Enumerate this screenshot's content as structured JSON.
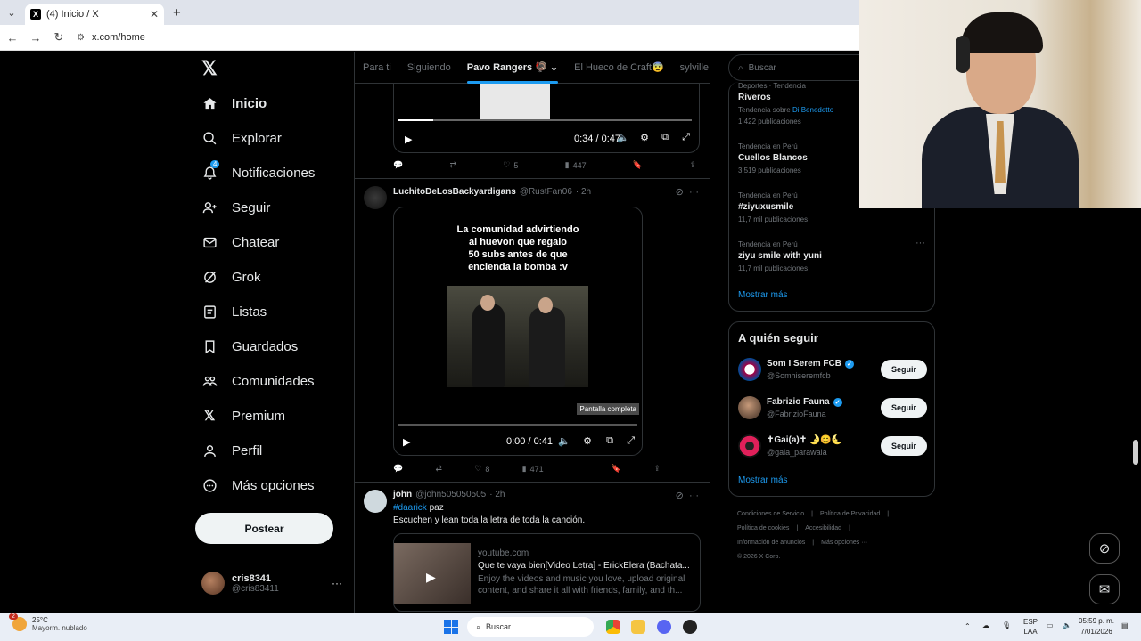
{
  "browser": {
    "tab_title": "(4) Inicio / X",
    "favicon": "X",
    "url": "x.com/home"
  },
  "nav": {
    "items": [
      {
        "label": "Inicio",
        "icon": "home-icon"
      },
      {
        "label": "Explorar",
        "icon": "search-icon"
      },
      {
        "label": "Notificaciones",
        "icon": "bell-icon",
        "badge": "4"
      },
      {
        "label": "Seguir",
        "icon": "person-add-icon"
      },
      {
        "label": "Chatear",
        "icon": "mail-icon"
      },
      {
        "label": "Grok",
        "icon": "grok-icon"
      },
      {
        "label": "Listas",
        "icon": "list-icon"
      },
      {
        "label": "Guardados",
        "icon": "bookmark-icon"
      },
      {
        "label": "Comunidades",
        "icon": "communities-icon"
      },
      {
        "label": "Premium",
        "icon": "x-icon"
      },
      {
        "label": "Perfil",
        "icon": "person-icon"
      },
      {
        "label": "Más opciones",
        "icon": "more-circle-icon"
      }
    ],
    "post_button": "Postear",
    "account": {
      "name": "cris8341",
      "handle": "@cris83411"
    }
  },
  "feed_tabs": [
    "Para ti",
    "Siguiendo",
    "Pavo Rangers 🦃",
    "El Hueco de Craft😨",
    "sylville"
  ],
  "tweets": [
    {
      "video_time": "0:34 / 0:47",
      "progress": 0.12,
      "stats": {
        "reply": "",
        "retweet": "",
        "like": "5",
        "views": "447"
      }
    },
    {
      "name": "LuchitoDeLosBackyardigans",
      "handle": "@RustFan06",
      "time": "· 2h",
      "meme_text": "La comunidad advirtiendo\nal huevon que regalo\n50 subs antes de que\nencienda la bomba :v",
      "tooltip": "Pantalla completa",
      "video_time": "0:00 / 0:41",
      "progress": 0.0,
      "stats": {
        "reply": "",
        "retweet": "",
        "like": "8",
        "views": "471"
      }
    },
    {
      "name": "john",
      "handle": "@john505050505",
      "time": "· 2h",
      "hashtag": "#daarick",
      "after_tag": " paz",
      "text": "Escuchen y lean toda la letra de toda la canción.",
      "card": {
        "domain": "youtube.com",
        "title": "Que te vaya bien[Video Letra] - ErickElera (Bachata...",
        "desc": "Enjoy the videos and music you love, upload original content, and share it all with friends, family, and th..."
      }
    }
  ],
  "right": {
    "search_placeholder": "Buscar",
    "trends": [
      {
        "ctx": "Deportes · Tendencia",
        "title": "Riveros",
        "count_prefix": "Tendencia sobre ",
        "count_link": "Di Benedetto",
        "count2": "1.422 publicaciones"
      },
      {
        "ctx": "Tendencia en Perú",
        "title": "Cuellos Blancos",
        "count": "3.519 publicaciones"
      },
      {
        "ctx": "Tendencia en Perú",
        "title": "#ziyuxusmile",
        "count": "11,7 mil publicaciones"
      },
      {
        "ctx": "Tendencia en Perú",
        "title": "ziyu smile with yuni",
        "count": "11,7 mil publicaciones"
      }
    ],
    "show_more": "Mostrar más",
    "follow_title": "A quién seguir",
    "follow": [
      {
        "name": "Som I Serem FCB",
        "handle": "@Somhiseremfcb",
        "verified": true,
        "btn": "Seguir"
      },
      {
        "name": "Fabrizio Fauna",
        "handle": "@FabrizioFauna",
        "verified": true,
        "btn": "Seguir"
      },
      {
        "name": "✝Gai(a)✝ 🌛😊🌜",
        "handle": "@gaia_parawala",
        "verified": false,
        "btn": "Seguir"
      }
    ],
    "footer": [
      "Condiciones de Servicio",
      "|",
      "Política de Privacidad",
      "|",
      "Política de cookies",
      "|",
      "Accesibilidad",
      "|",
      "Información de anuncios",
      "|",
      "Más opciones ···",
      "© 2026 X Corp."
    ]
  },
  "taskbar": {
    "temp": "25°C",
    "condition": "Mayorm. nublado",
    "weather_badge": "2",
    "search": "Buscar",
    "lang1": "ESP",
    "lang2": "LAA",
    "time": "05:59 p. m.",
    "date": "7/01/2026"
  },
  "colors": {
    "accent": "#1d9bf0",
    "background": "#000000",
    "border": "#2f3336"
  }
}
